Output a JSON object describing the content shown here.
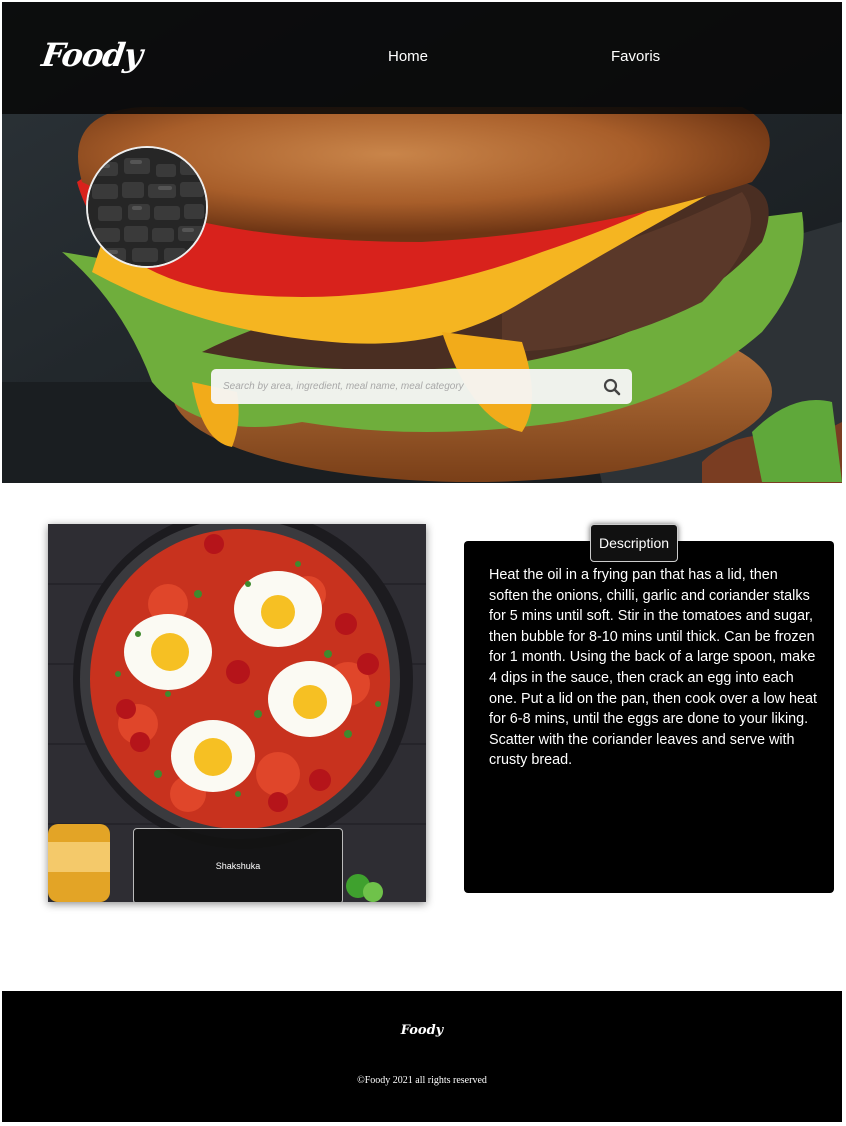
{
  "nav": {
    "logo": "Foody",
    "links": [
      "Home",
      "Favoris"
    ]
  },
  "search": {
    "placeholder": "Search by area, ingredient, meal name, meal category",
    "icon": "search-icon"
  },
  "meal": {
    "name": "Shakshuka",
    "description_tab": "Description",
    "description": "Heat the oil in a frying pan that has a lid, then soften the onions, chilli, garlic and coriander stalks for 5 mins until soft. Stir in the tomatoes and sugar, then bubble for 8-10 mins until thick. Can be frozen for 1 month. Using the back of a large spoon, make 4 dips in the sauce, then crack an egg into each one. Put a lid on the pan, then cook over a low heat for 6-8 mins, until the eggs are done to your liking. Scatter with the coriander leaves and serve with crusty bread."
  },
  "footer": {
    "logo": "Foody",
    "copyright": "©Foody 2021 all rights reserved"
  },
  "colors": {
    "navbar": "#080808",
    "footer": "#000000",
    "panel": "#000000",
    "text": "#ffffff"
  }
}
